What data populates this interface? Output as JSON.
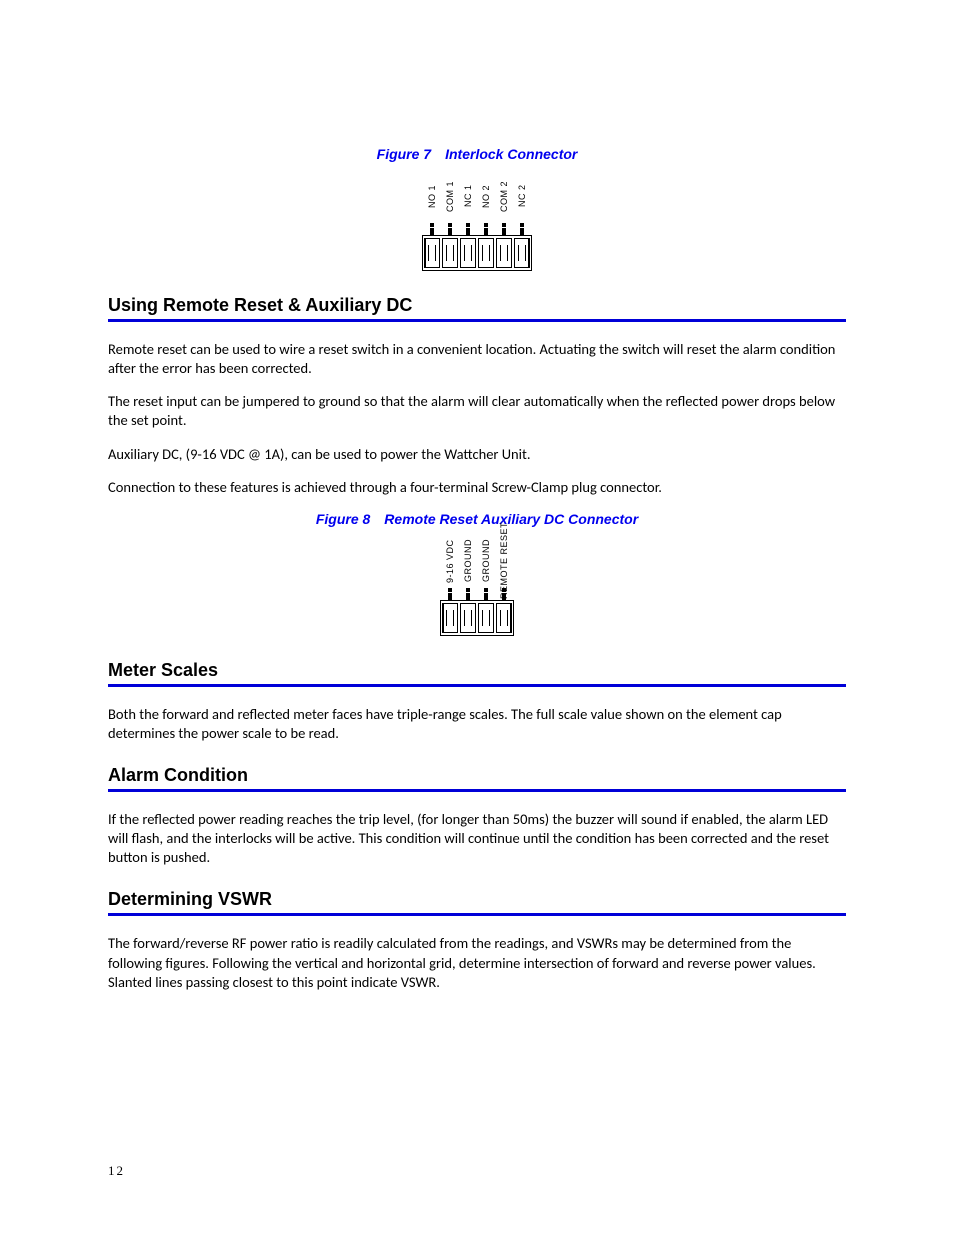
{
  "figure7": {
    "label_prefix": "Figure 7",
    "title": "Interlock Connector",
    "pins": [
      "NO 1",
      "COM 1",
      "NC 1",
      "NO 2",
      "COM 2",
      "NC 2"
    ]
  },
  "section1": {
    "title": "Using Remote Reset & Auxiliary DC",
    "p1": "Remote reset can be used to wire a reset switch in a convenient location. Actuating the switch will reset the alarm condition after the error has been corrected.",
    "p2": "The reset input can be jumpered to ground so that the alarm will clear automatically when the reflected power drops below the set point.",
    "p3": "Auxiliary DC, (9-16 VDC @ 1A), can be used to power the Wattcher Unit.",
    "p4": "Connection to these features is achieved through a four-terminal Screw-Clamp plug connector."
  },
  "figure8": {
    "label_prefix": "Figure 8",
    "title": "Remote Reset Auxiliary DC Connector",
    "pins": [
      "9-16 VDC",
      "GROUND",
      "GROUND",
      "REMOTE RESET"
    ]
  },
  "section2": {
    "title": "Meter Scales",
    "p1": "Both the forward and reflected meter faces have triple-range scales. The full scale value shown on the element cap determines the power scale to be read."
  },
  "section3": {
    "title": "Alarm Condition",
    "p1": "If the reflected power reading reaches the trip level, (for longer than 50ms) the buzzer will sound if enabled, the alarm LED will flash, and the interlocks will be active. This condition will continue until the condition has been corrected and the reset button is pushed."
  },
  "section4": {
    "title": "Determining VSWR",
    "p1": "The forward/reverse RF power ratio is readily calculated from the readings, and VSWRs may be determined from the following figures. Following the vertical and horizontal grid, determine intersection of forward and reverse power values. Slanted lines passing closest to this point indicate VSWR."
  },
  "page_number": "12"
}
